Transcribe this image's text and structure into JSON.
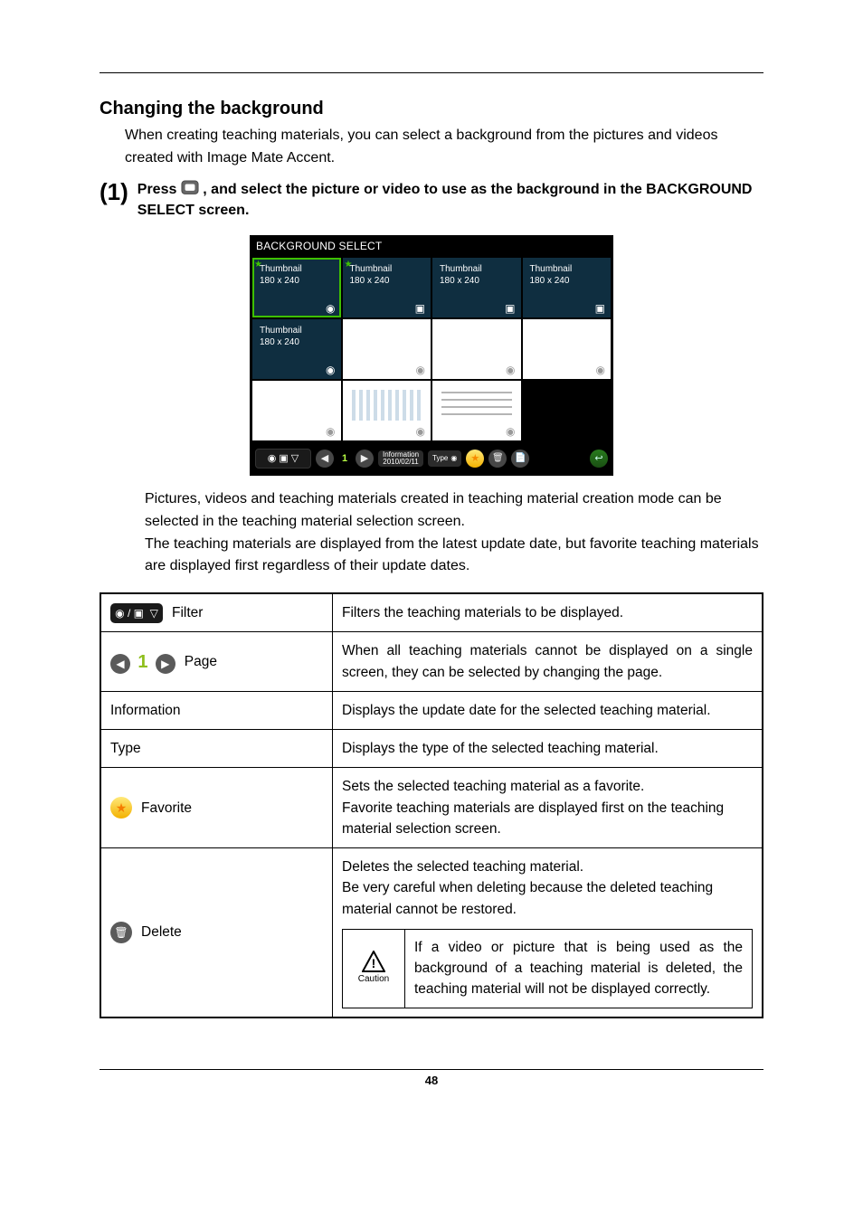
{
  "heading": "Changing the background",
  "intro": "When creating teaching materials, you can select a background from the pictures and videos created with Image Mate Accent.",
  "step": {
    "num": "(1)",
    "text_a": "Press ",
    "text_b": " , and select the picture or video to use as the background in the BACKGROUND SELECT screen."
  },
  "figure": {
    "title": "BACKGROUND SELECT",
    "thumb_label_a": "Thumbnail",
    "thumb_label_b": "180 x 240",
    "toolbar": {
      "page_num": "1",
      "info_top": "Information",
      "info_bottom": "2010/02/11",
      "type": "Type"
    }
  },
  "desc_a": "Pictures, videos and teaching materials created in teaching material creation mode can be selected in the teaching material selection screen.",
  "desc_b": "The teaching materials are displayed from the latest update date, but favorite teaching materials are displayed first regardless of their update dates.",
  "table": {
    "filter": {
      "label": "Filter",
      "desc": "Filters the teaching materials to be displayed."
    },
    "page": {
      "label": "Page",
      "desc": "When all teaching materials cannot be displayed on a single screen, they can be selected by changing the page."
    },
    "information": {
      "label": "Information",
      "desc": "Displays the update date for the selected teaching material."
    },
    "type": {
      "label": "Type",
      "desc": "Displays the type of the selected teaching material."
    },
    "favorite": {
      "label": "Favorite",
      "desc": "Sets the selected teaching material as a favorite.\nFavorite teaching materials are displayed first on the teaching material selection screen."
    },
    "delete": {
      "label": "Delete",
      "desc_a": "Deletes the selected teaching material.",
      "desc_b": "Be very careful when deleting because the deleted teaching material cannot be restored.",
      "caution_label": "Caution",
      "caution_text": "If a video or picture that is being used as the background of a teaching material is deleted, the teaching material will not be displayed correctly."
    }
  },
  "page_number": "48"
}
